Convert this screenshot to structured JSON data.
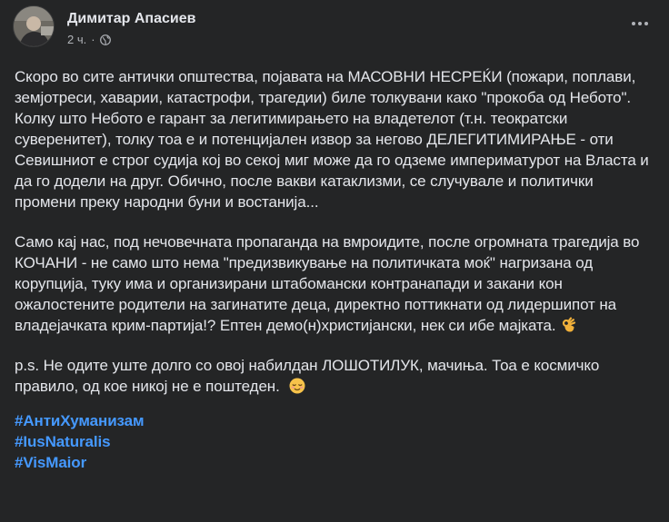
{
  "post": {
    "author": "Димитар Апасиев",
    "time": "2 ч.",
    "separator": "·",
    "privacy_icon": "globe-icon",
    "more_icon": "more-options-icon"
  },
  "content": {
    "paragraph1": "Скоро во сите антички општества, појавата на МАСОВНИ НЕСРЕЌИ (пожари, поплави, земјотреси, хаварии, катастрофи, трагедии) биле толкувани како \"прокоба од Небото\". Колку што Небото е гарант за легитимирањето на владетелот (т.н. теократски суверенитет), толку тоа е и потенцијален извор за негово ДЕЛЕГИТИМИРАЊЕ - оти Севишниот е строг судија кој во секој миг може да го одземе империматурот на Власта и да го додели на друг. Обично, после вакви катаклизми, се случувале и политички промени преку народни буни и востанија...",
    "paragraph2": "Само кај нас, под нечовечната пропаганда на вмроидите, после огромната трагедија во КОЧАНИ - не само што нема \"предизвикување на политичката моќ\" нагризана од корупција, туку има и организирани штабомански контранапади и закани кон ожалостените родители на загинатите деца, директно поттикнати од лидершипот на владејачката крим-партија!? Ептен демо(н)христијански, нек си ибе мајката.",
    "paragraph2_emoji": "ok-hand-emoji",
    "paragraph3": "p.s. Не одите уште долго со овој набилдан ЛОШОТИЛУК, мачиња. Тоа е космичко правило, од кое никој не е поштеден.",
    "paragraph3_emoji": "relieved-face-emoji",
    "hashtags": [
      "#АнтиХуманизам",
      "#IusNaturalis",
      "#VisMaior"
    ]
  },
  "colors": {
    "background": "#242526",
    "text": "#e4e6eb",
    "secondary_text": "#b0b3b8",
    "hashtag": "#4599ff"
  }
}
